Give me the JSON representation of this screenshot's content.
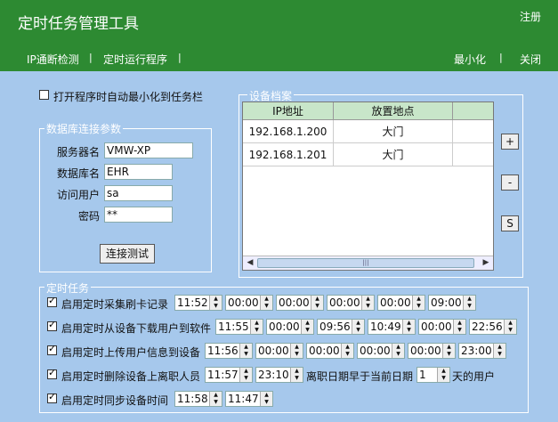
{
  "header": {
    "title": "定时任务管理工具",
    "register": "注册",
    "nav": [
      "IP通断检测",
      "定时运行程序",
      ""
    ],
    "minimize": "最小化",
    "close": "关闭",
    "separator": "|"
  },
  "startup": {
    "label": "打开程序时自动最小化到任务栏",
    "checked": false
  },
  "db": {
    "group_title": "数据库连接参数",
    "fields": [
      {
        "label": "服务器名",
        "value": "VMW-XP"
      },
      {
        "label": "数据库名",
        "value": "EHR"
      },
      {
        "label": "访问用户",
        "value": "sa"
      },
      {
        "label": "密码",
        "value": "**"
      }
    ],
    "test_button": "连接测试"
  },
  "devices": {
    "group_title": "设备档案",
    "columns": [
      "IP地址",
      "放置地点"
    ],
    "rows": [
      {
        "ip": "192.168.1.200",
        "place": "大门"
      },
      {
        "ip": "192.168.1.201",
        "place": "大门"
      }
    ],
    "add": "+",
    "remove": "-",
    "save": "S"
  },
  "tasks": {
    "group_title": "定时任务",
    "items": [
      {
        "label": "启用定时采集刷卡记录",
        "checked": true,
        "times": [
          "11:52",
          "00:00",
          "00:00",
          "00:00",
          "00:00",
          "09:00"
        ]
      },
      {
        "label": "启用定时从设备下载用户到软件",
        "checked": true,
        "times": [
          "11:55",
          "00:00",
          "09:56",
          "10:49",
          "00:00",
          "22:56"
        ]
      },
      {
        "label": "启用定时上传用户信息到设备",
        "checked": true,
        "times": [
          "11:56",
          "00:00",
          "00:00",
          "00:00",
          "00:00",
          "23:00"
        ]
      },
      {
        "label": "启用定时删除设备上离职人员",
        "checked": true,
        "times": [
          "11:57",
          "23:10"
        ],
        "extra_label": "离职日期早于当前日期",
        "days": "1",
        "days_suffix": "天的用户"
      },
      {
        "label": "启用定时同步设备时间",
        "checked": true,
        "times": [
          "11:58",
          "11:47"
        ]
      }
    ]
  }
}
